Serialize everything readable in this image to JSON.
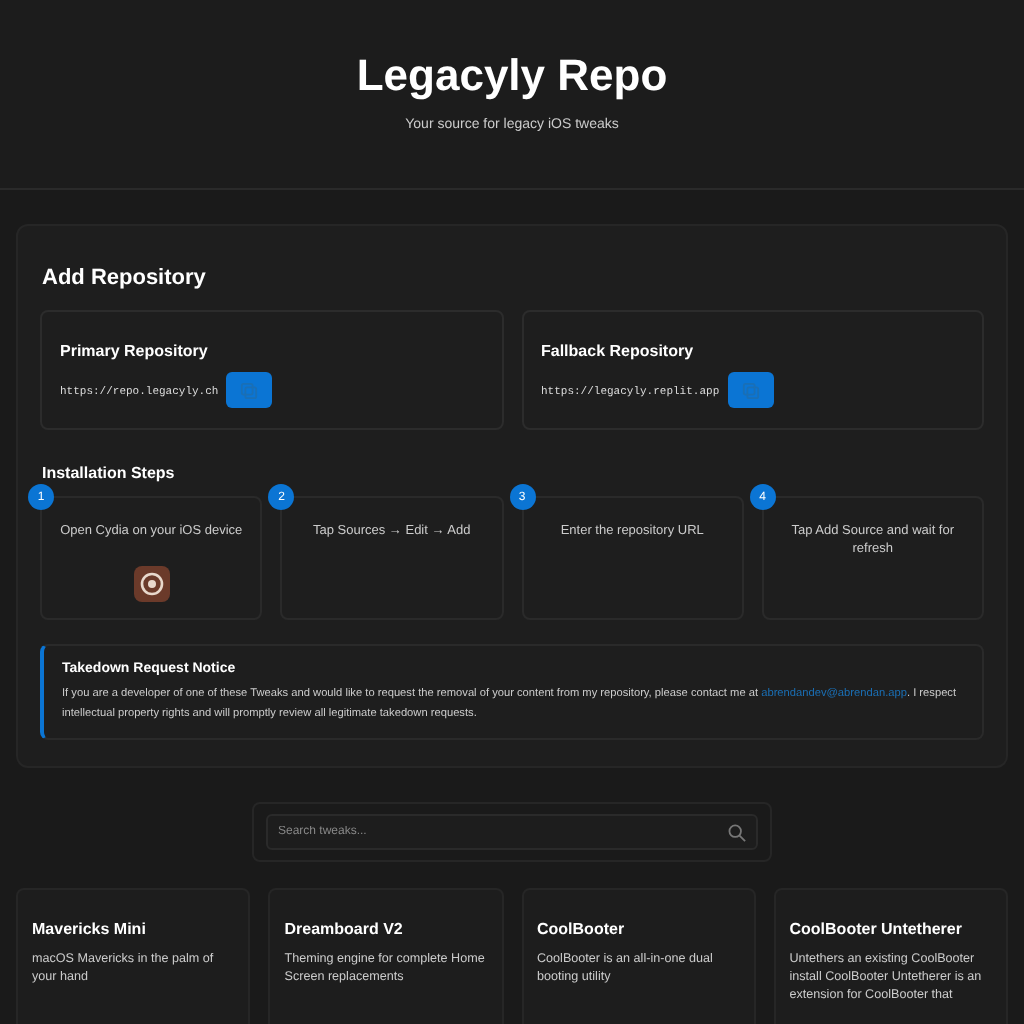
{
  "header": {
    "title": "Legacyly Repo",
    "subtitle": "Your source for legacy iOS tweaks"
  },
  "add_repository": {
    "title": "Add Repository",
    "repositories": [
      {
        "title": "Primary Repository",
        "url": "https://repo.legacyly.ch"
      },
      {
        "title": "Fallback Repository",
        "url": "https://legacyly.replit.app"
      }
    ]
  },
  "installation_steps": {
    "title": "Installation Steps",
    "steps": [
      {
        "number": "1",
        "text": "Open Cydia on your iOS device",
        "kind": "app-icon"
      },
      {
        "number": "2",
        "text": "Tap Sources → Edit → Add",
        "kind": "plain"
      },
      {
        "number": "3",
        "text": "Enter the repository URL",
        "kind": "plain"
      },
      {
        "number": "4",
        "text": "Tap Add Source and wait for refresh",
        "kind": "plain"
      }
    ]
  },
  "notice": {
    "title": "Takedown Request Notice",
    "text_before": "If you are a developer of one of these Tweaks and would like to request the removal of your content from my repository, please contact me at",
    "email": "abrendandev@abrendan.app",
    "text_after": ". I respect intellectual property rights and will promptly review all legitimate takedown requests."
  },
  "search": {
    "placeholder": "Search tweaks..."
  },
  "tweaks": [
    {
      "name": "Mavericks Mini",
      "description": "macOS Mavericks in the palm of your hand"
    },
    {
      "name": "Dreamboard V2",
      "description": "Theming engine for complete Home Screen replacements"
    },
    {
      "name": "CoolBooter",
      "description": "CoolBooter is an all-in-one dual booting utility"
    },
    {
      "name": "CoolBooter Untetherer",
      "description": "Untethers an existing CoolBooter install CoolBooter Untetherer is an extension for CoolBooter that"
    }
  ]
}
